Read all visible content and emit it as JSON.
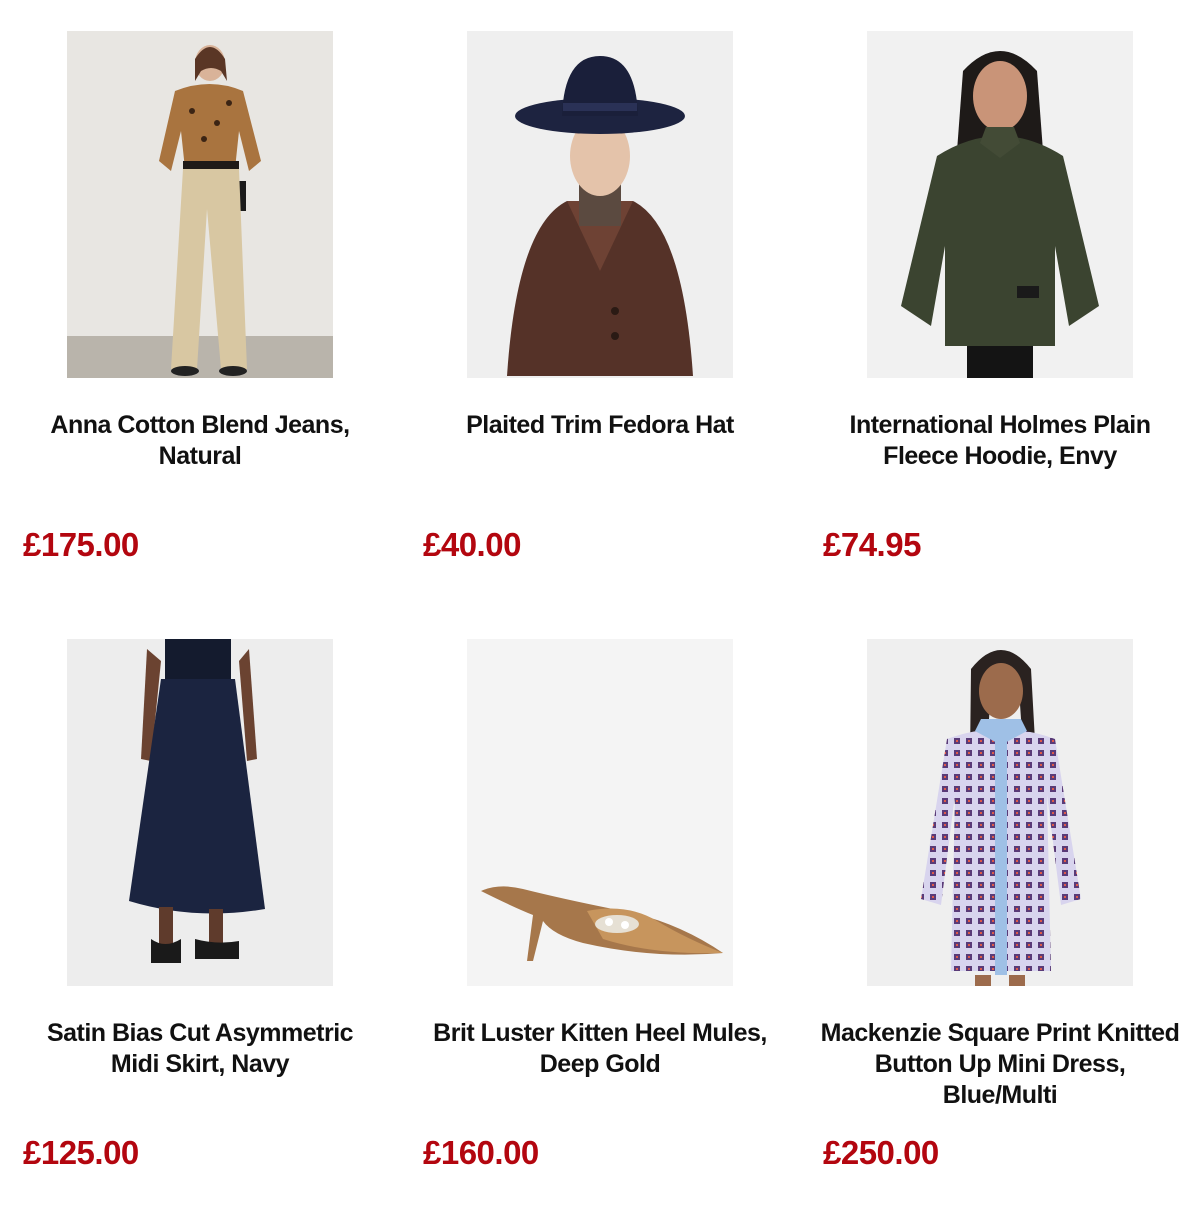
{
  "products": [
    {
      "name": "Anna Cotton Blend Jeans, Natural",
      "price": "£175.00",
      "image_icon": "woman-leopard-blouse-cream-jeans-photo"
    },
    {
      "name": "Plaited Trim Fedora Hat",
      "price": "£40.00",
      "image_icon": "woman-navy-fedora-brown-coat-photo"
    },
    {
      "name": "International Holmes Plain Fleece Hoodie, Envy",
      "price": "£74.95",
      "image_icon": "woman-green-fleece-hoodie-photo"
    },
    {
      "name": "Satin Bias Cut Asymmetric Midi Skirt, Navy",
      "price": "£125.00",
      "image_icon": "navy-midi-skirt-sandals-photo"
    },
    {
      "name": "Brit Luster Kitten Heel Mules, Deep Gold",
      "price": "£160.00",
      "image_icon": "gold-kitten-heel-mule-photo"
    },
    {
      "name": "Mackenzie Square Print Knitted Button Up Mini Dress, Blue/Multi",
      "price": "£250.00",
      "image_icon": "woman-blue-square-print-dress-photo"
    }
  ],
  "colors": {
    "price": "#b3060f",
    "title": "#111111",
    "background": "#ffffff",
    "image_bg": "#eeeeee"
  }
}
